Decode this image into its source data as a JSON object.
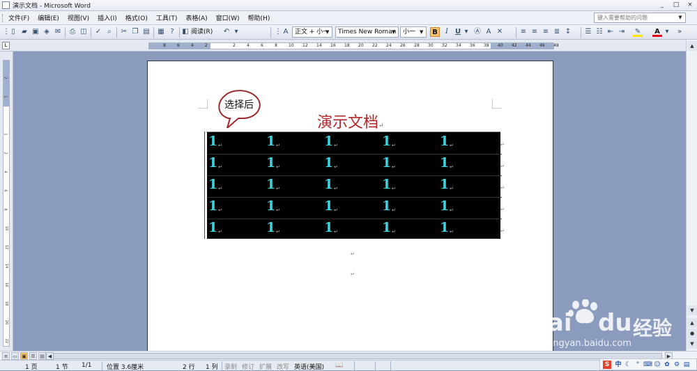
{
  "window": {
    "title": "演示文档 - Microsoft Word"
  },
  "window_buttons": [
    "_",
    "□",
    "×"
  ],
  "menu": [
    "文件(F)",
    "编辑(E)",
    "视图(V)",
    "插入(I)",
    "格式(O)",
    "工具(T)",
    "表格(A)",
    "窗口(W)",
    "帮助(H)"
  ],
  "help_box": {
    "placeholder": "键入需要帮助的问题"
  },
  "toolbar": {
    "read_label": "阅读(R)",
    "style_value": "正文 + 小一",
    "font_value": "Times New Roman",
    "size_value": "小一",
    "bold_label": "B",
    "italic_label": "I",
    "underline_label": "U",
    "highlight_color": "#ffe600",
    "font_color": "#e0001a"
  },
  "ruler": {
    "corner_label": "L",
    "ticks": [
      "8",
      "6",
      "4",
      "2",
      "",
      "2",
      "4",
      "6",
      "8",
      "10",
      "12",
      "14",
      "16",
      "18",
      "20",
      "22",
      "24",
      "26",
      "28",
      "30",
      "32",
      "34",
      "36",
      "38",
      "40",
      "42",
      "44",
      "46",
      "48"
    ],
    "vertical_ticks": [
      "2",
      "1",
      "",
      "1",
      "2",
      "4",
      "6",
      "8",
      "10",
      "12",
      "14",
      "16",
      "18",
      "20",
      "22"
    ]
  },
  "document": {
    "callout": "选择后",
    "heading": "演示文档",
    "table": {
      "rows": [
        [
          "1",
          "1",
          "1",
          "1",
          "1"
        ],
        [
          "1",
          "1",
          "1",
          "1",
          "1"
        ],
        [
          "1",
          "1",
          "1",
          "1",
          "1"
        ],
        [
          "1",
          "1",
          "1",
          "1",
          "1"
        ],
        [
          "1",
          "1",
          "1",
          "1",
          "1"
        ]
      ],
      "cell_mark": "↵",
      "text_color": "#3ed4df",
      "selection_color": "#000000"
    },
    "paragraph_mark": "↵"
  },
  "status": {
    "page": "1 页",
    "section": "1 节",
    "page_of": "1/1",
    "position": "位置 3.6厘米",
    "line": "2 行",
    "column": "1 列",
    "rec": "录制",
    "trk": "修订",
    "ext": "扩展",
    "ovr": "改写",
    "language": "英语(美国)"
  },
  "tray": {
    "ime": "中",
    "brand": "S"
  },
  "watermark": {
    "brand": "Bai",
    "brand2": "du",
    "cn": "经验",
    "url": "jingyan.baidu.com"
  }
}
